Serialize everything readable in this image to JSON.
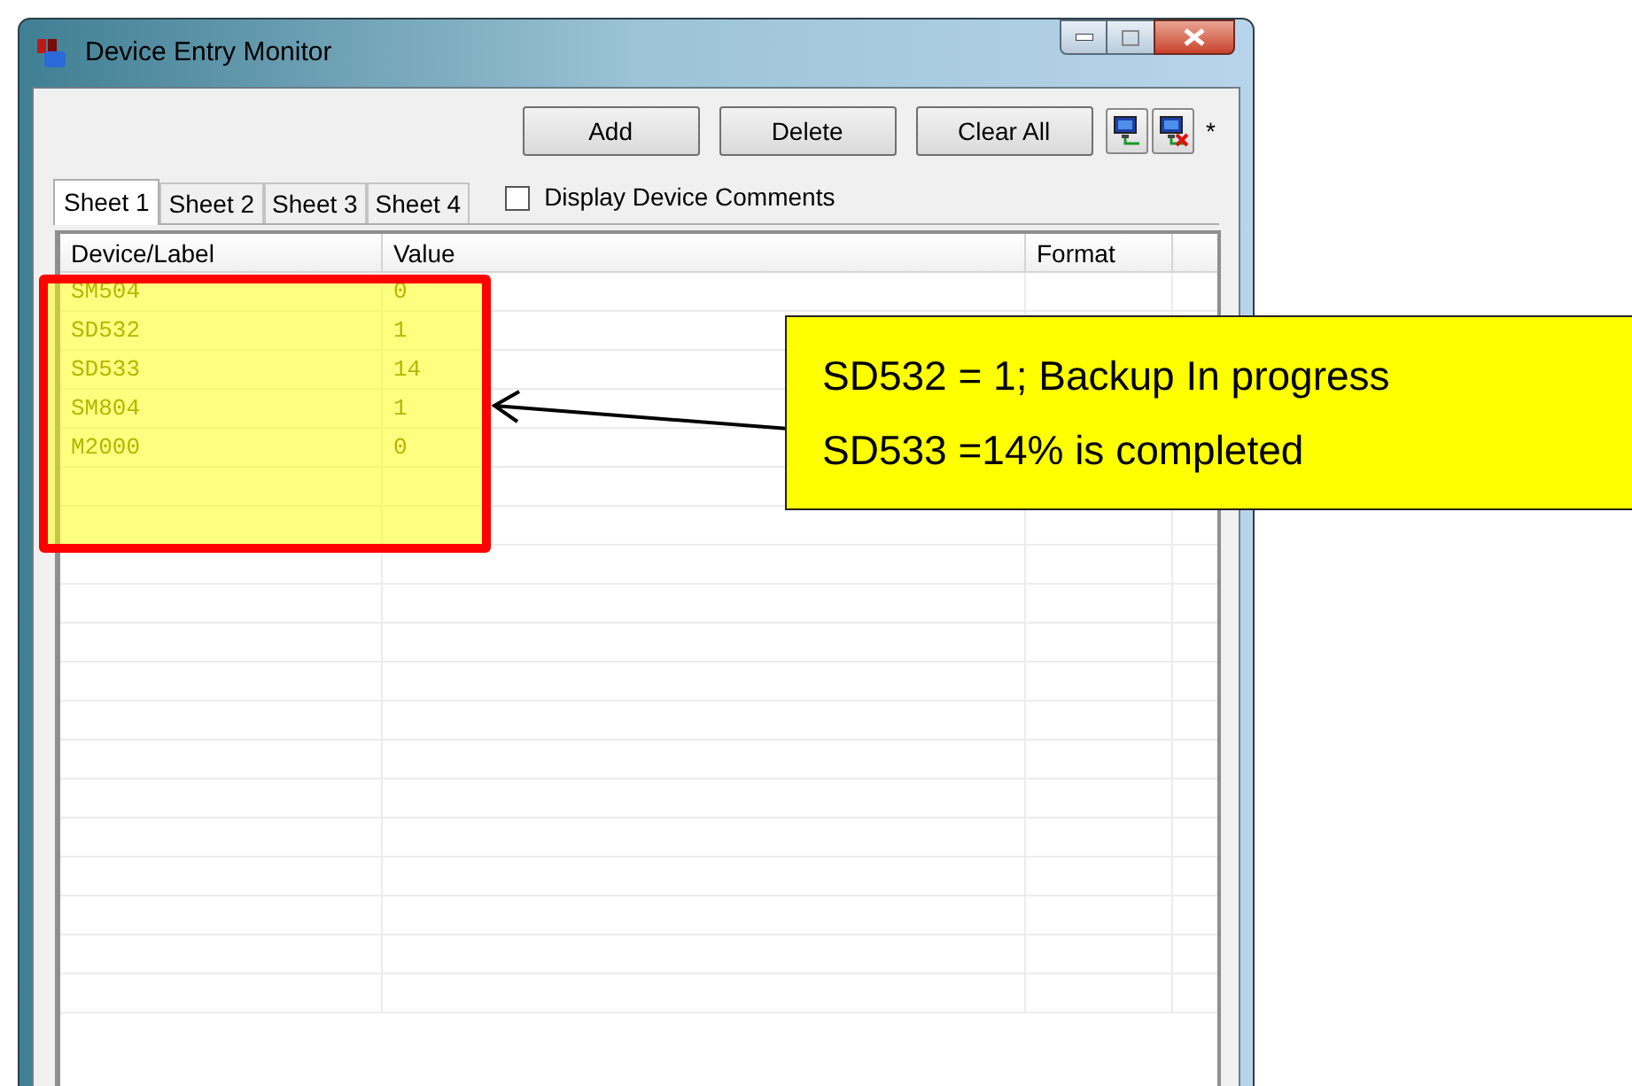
{
  "window": {
    "title": "Device Entry Monitor"
  },
  "toolbar": {
    "buttons": [
      "Add",
      "Delete",
      "Clear All"
    ],
    "modified_mark": "*"
  },
  "tabs": [
    {
      "label": "Sheet 1",
      "selected": true
    },
    {
      "label": "Sheet 2",
      "selected": false
    },
    {
      "label": "Sheet 3",
      "selected": false
    },
    {
      "label": "Sheet 4",
      "selected": false
    }
  ],
  "display_comments": {
    "label": "Display Device Comments",
    "checked": false
  },
  "table": {
    "columns": [
      "Device/Label",
      "Value",
      "Format"
    ],
    "rows": [
      {
        "device": "SM504",
        "value": "0"
      },
      {
        "device": "SD532",
        "value": "1"
      },
      {
        "device": "SD533",
        "value": "14"
      },
      {
        "device": "SM804",
        "value": "1"
      },
      {
        "device": "M2000",
        "value": "0"
      }
    ]
  },
  "callout": {
    "lines": [
      "SD532 = 1; Backup In progress",
      "SD533 =14% is completed"
    ]
  }
}
